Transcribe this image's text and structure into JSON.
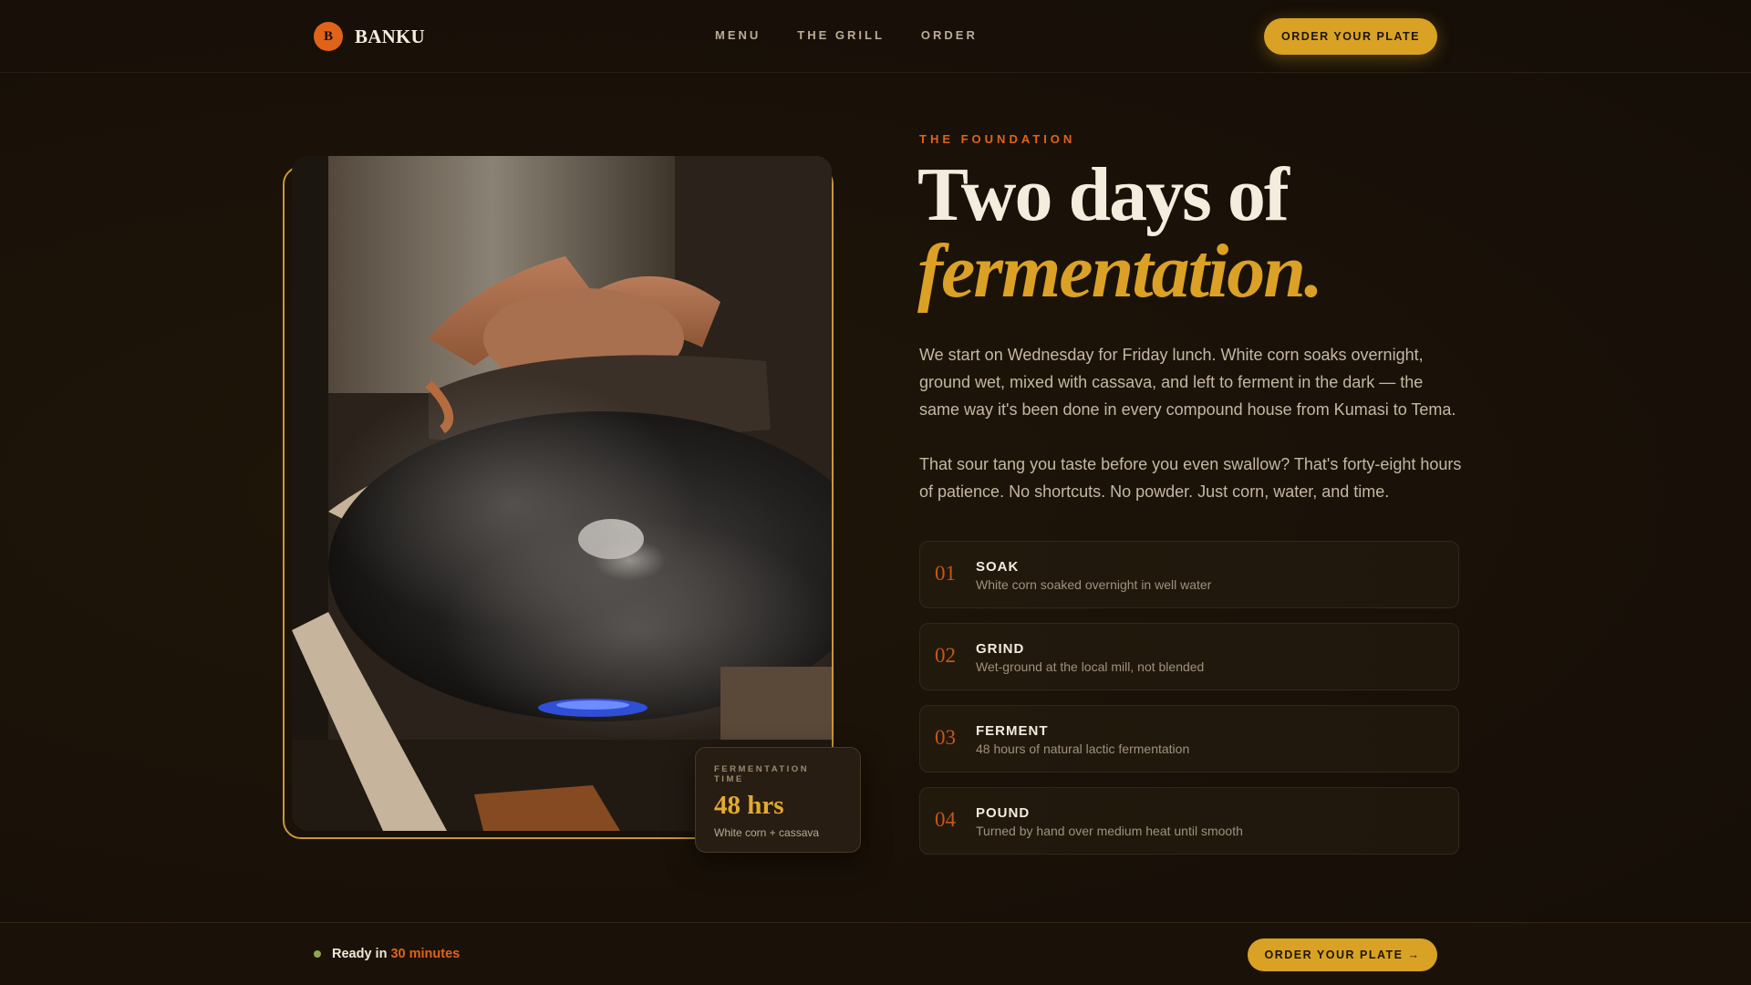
{
  "header": {
    "brand_initial": "B",
    "brand_name": "BANKU",
    "nav": [
      "MENU",
      "THE GRILL",
      "ORDER"
    ],
    "cta_label": "ORDER YOUR PLATE"
  },
  "hero": {
    "eyebrow": "THE FOUNDATION",
    "headline_line1": "Two days of",
    "headline_line2": "fermentation.",
    "paragraph1": "We start on Wednesday for Friday lunch. White corn soaks overnight, ground wet, mixed with cassava, and left to ferment in the dark — the same way it's been done in every compound house from Kumasi to Tema.",
    "paragraph2": "That sour tang you taste before you even swallow? That's forty-eight hours of patience. No shortcuts. No powder. Just corn, water, and time."
  },
  "stat_card": {
    "label": "FERMENTATION TIME",
    "value": "48 hrs",
    "sub": "White corn + cassava"
  },
  "steps": [
    {
      "num": "01",
      "title": "SOAK",
      "desc": "White corn soaked overnight in well water"
    },
    {
      "num": "02",
      "title": "GRIND",
      "desc": "Wet-ground at the local mill, not blended"
    },
    {
      "num": "03",
      "title": "FERMENT",
      "desc": "48 hours of natural lactic fermentation"
    },
    {
      "num": "04",
      "title": "POUND",
      "desc": "Turned by hand over medium heat until smooth"
    }
  ],
  "footer": {
    "ready_prefix": "Ready in",
    "ready_time": "30 minutes",
    "cta_label": "ORDER YOUR PLATE →"
  },
  "colors": {
    "background": "#1a1209",
    "accent_gold": "#d9a224",
    "accent_orange": "#e0631a",
    "status_green": "#8fa64a"
  }
}
